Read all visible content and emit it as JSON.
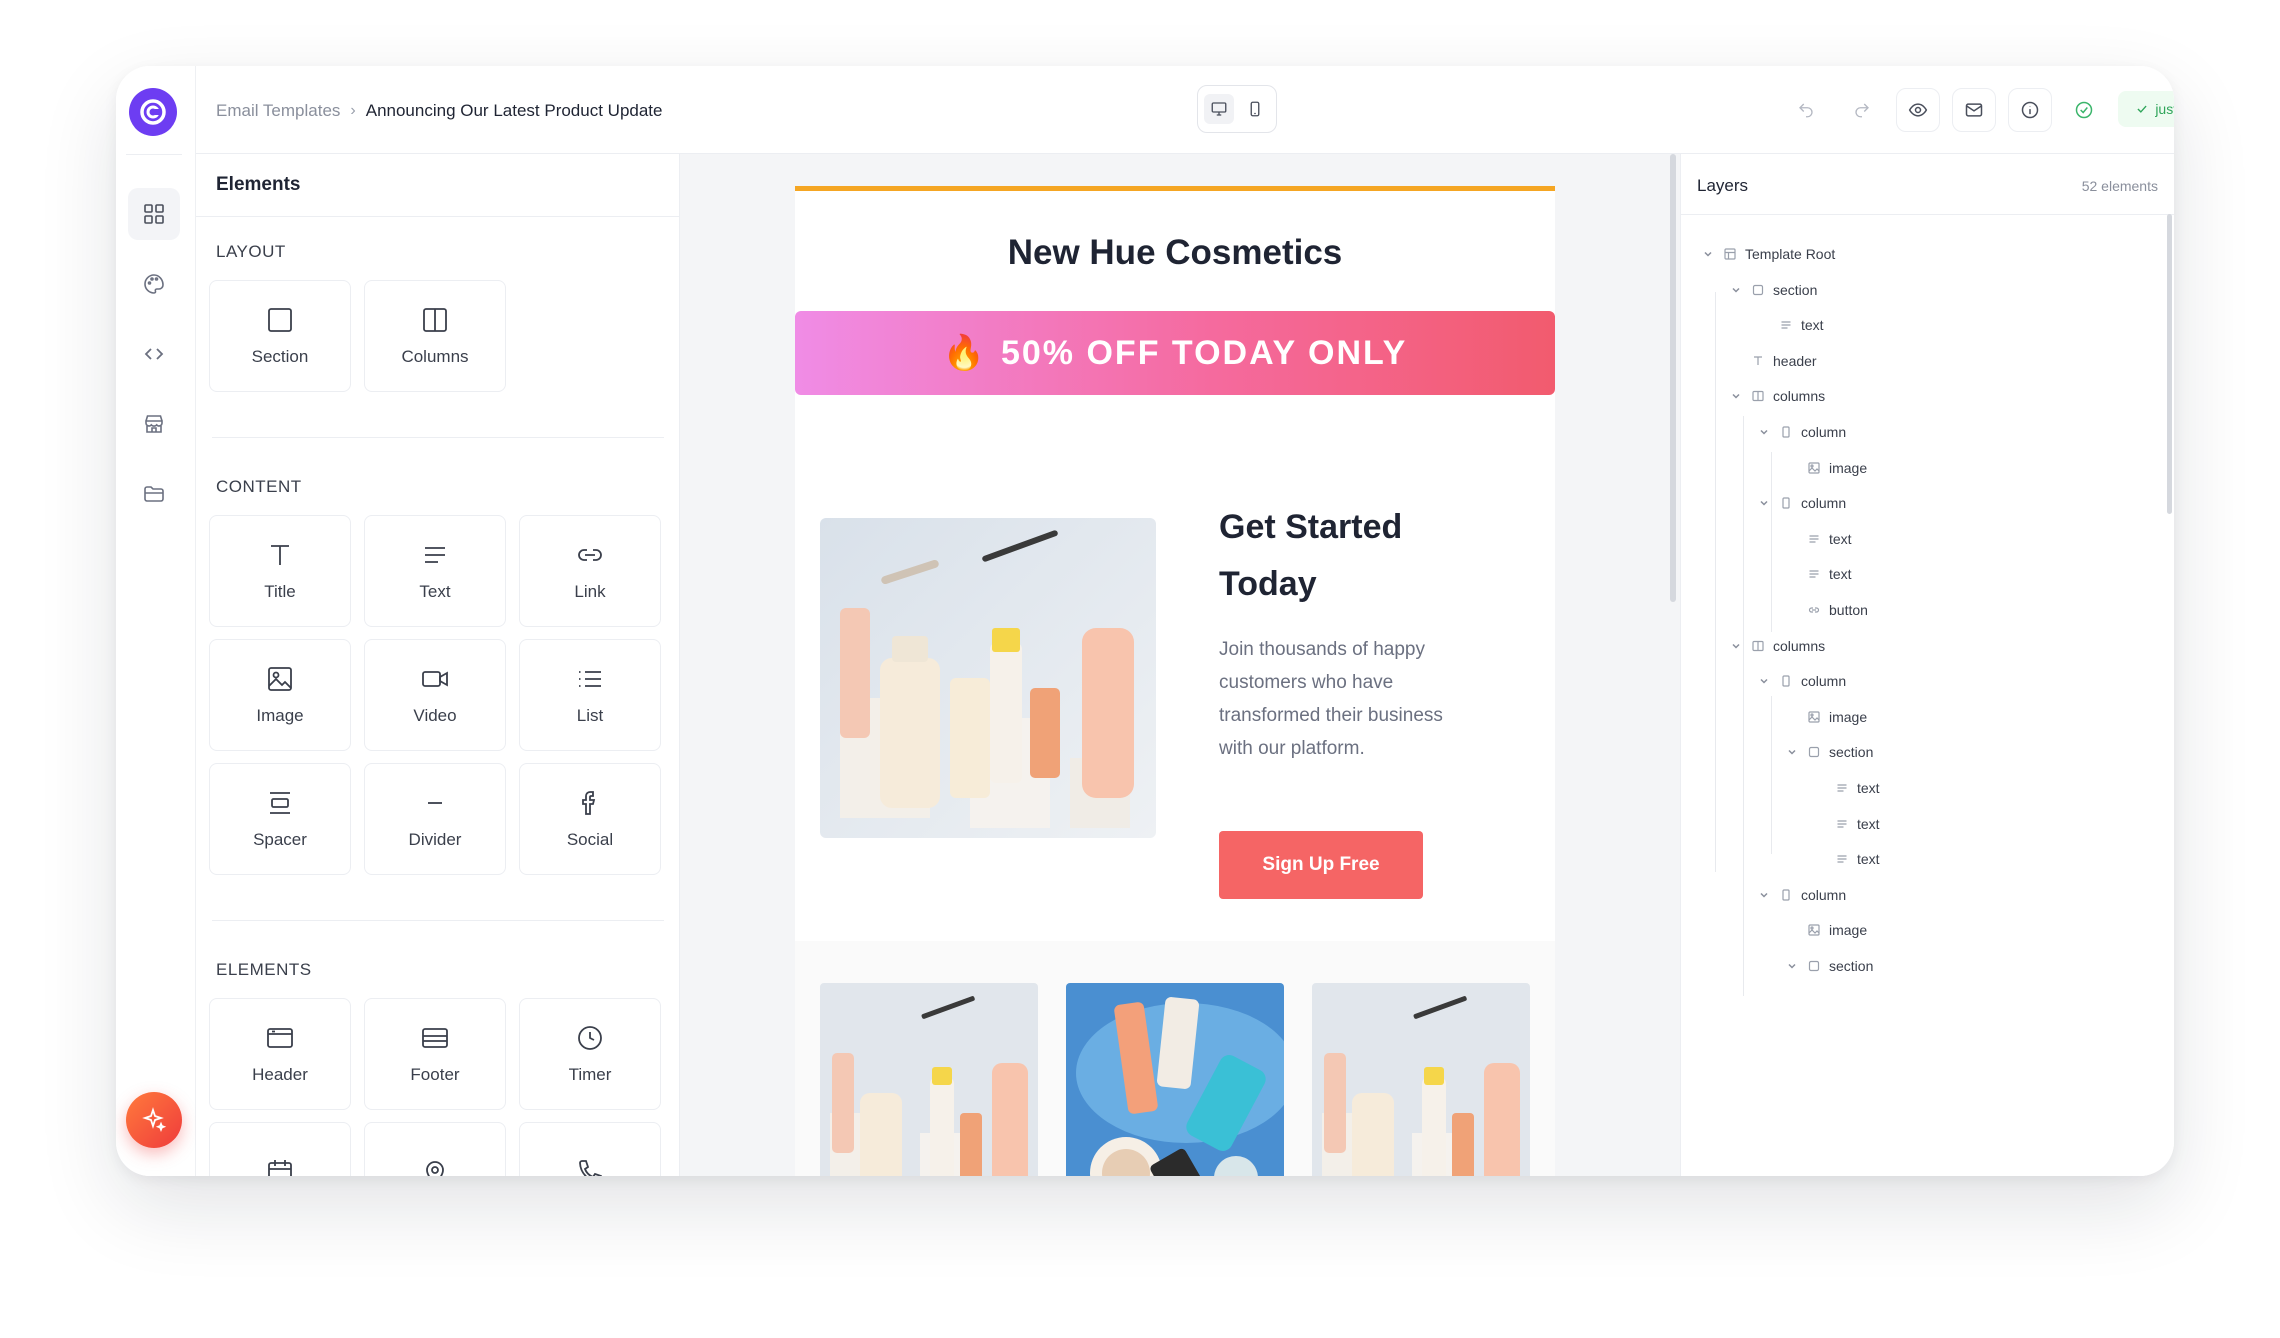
{
  "app": {
    "breadcrumb": {
      "parent": "Email Templates",
      "separator": "›",
      "current": "Announcing Our Latest Product Update"
    },
    "save_status": "just now"
  },
  "elements_panel": {
    "title": "Elements",
    "sections": [
      {
        "label": "LAYOUT",
        "items": [
          {
            "label": "Section",
            "icon": "section-icon"
          },
          {
            "label": "Columns",
            "icon": "columns-icon"
          }
        ]
      },
      {
        "label": "CONTENT",
        "items": [
          {
            "label": "Title",
            "icon": "title-icon"
          },
          {
            "label": "Text",
            "icon": "text-icon"
          },
          {
            "label": "Link",
            "icon": "link-icon"
          },
          {
            "label": "Image",
            "icon": "image-icon"
          },
          {
            "label": "Video",
            "icon": "video-icon"
          },
          {
            "label": "List",
            "icon": "list-icon"
          },
          {
            "label": "Spacer",
            "icon": "spacer-icon"
          },
          {
            "label": "Divider",
            "icon": "divider-icon"
          },
          {
            "label": "Social",
            "icon": "facebook-icon"
          }
        ]
      },
      {
        "label": "ELEMENTS",
        "items": [
          {
            "label": "Header",
            "icon": "header-icon"
          },
          {
            "label": "Footer",
            "icon": "footer-icon"
          },
          {
            "label": "Timer",
            "icon": "clock-icon"
          },
          {
            "label": "",
            "icon": "calendar-icon"
          },
          {
            "label": "",
            "icon": "map-pin-icon"
          },
          {
            "label": "",
            "icon": "phone-icon"
          }
        ]
      }
    ]
  },
  "email": {
    "brand": "New Hue Cosmetics",
    "promo_emoji": "🔥",
    "promo": "50% OFF TODAY ONLY",
    "hero_heading_line1": "Get Started",
    "hero_heading_line2": "Today",
    "hero_body": "Join thousands of happy customers who have transformed their business with our platform.",
    "cta": "Sign Up Free",
    "colors": {
      "accent_bar": "#f5a623",
      "cta": "#f56565",
      "promo_start": "#f08ce6",
      "promo_end": "#f25b6e"
    }
  },
  "layers": {
    "title": "Layers",
    "count": "52 elements",
    "items": [
      {
        "label": "Template Root",
        "type": "template",
        "depth": 0,
        "expandable": true
      },
      {
        "label": "section",
        "type": "section",
        "depth": 1,
        "expandable": true
      },
      {
        "label": "text",
        "type": "text",
        "depth": 2,
        "expandable": false
      },
      {
        "label": "header",
        "type": "header",
        "depth": 1,
        "expandable": false
      },
      {
        "label": "columns",
        "type": "columns",
        "depth": 1,
        "expandable": true
      },
      {
        "label": "column",
        "type": "column",
        "depth": 2,
        "expandable": true
      },
      {
        "label": "image",
        "type": "image",
        "depth": 3,
        "expandable": false
      },
      {
        "label": "column",
        "type": "column",
        "depth": 2,
        "expandable": true
      },
      {
        "label": "text",
        "type": "text",
        "depth": 3,
        "expandable": false
      },
      {
        "label": "text",
        "type": "text",
        "depth": 3,
        "expandable": false
      },
      {
        "label": "button",
        "type": "button",
        "depth": 3,
        "expandable": false
      },
      {
        "label": "columns",
        "type": "columns",
        "depth": 1,
        "expandable": true
      },
      {
        "label": "column",
        "type": "column",
        "depth": 2,
        "expandable": true
      },
      {
        "label": "image",
        "type": "image",
        "depth": 3,
        "expandable": false
      },
      {
        "label": "section",
        "type": "section",
        "depth": 3,
        "expandable": true
      },
      {
        "label": "text",
        "type": "text",
        "depth": 4,
        "expandable": false
      },
      {
        "label": "text",
        "type": "text",
        "depth": 4,
        "expandable": false
      },
      {
        "label": "text",
        "type": "text",
        "depth": 4,
        "expandable": false
      },
      {
        "label": "column",
        "type": "column",
        "depth": 2,
        "expandable": true
      },
      {
        "label": "image",
        "type": "image",
        "depth": 3,
        "expandable": false
      },
      {
        "label": "section",
        "type": "section",
        "depth": 3,
        "expandable": true
      }
    ]
  }
}
